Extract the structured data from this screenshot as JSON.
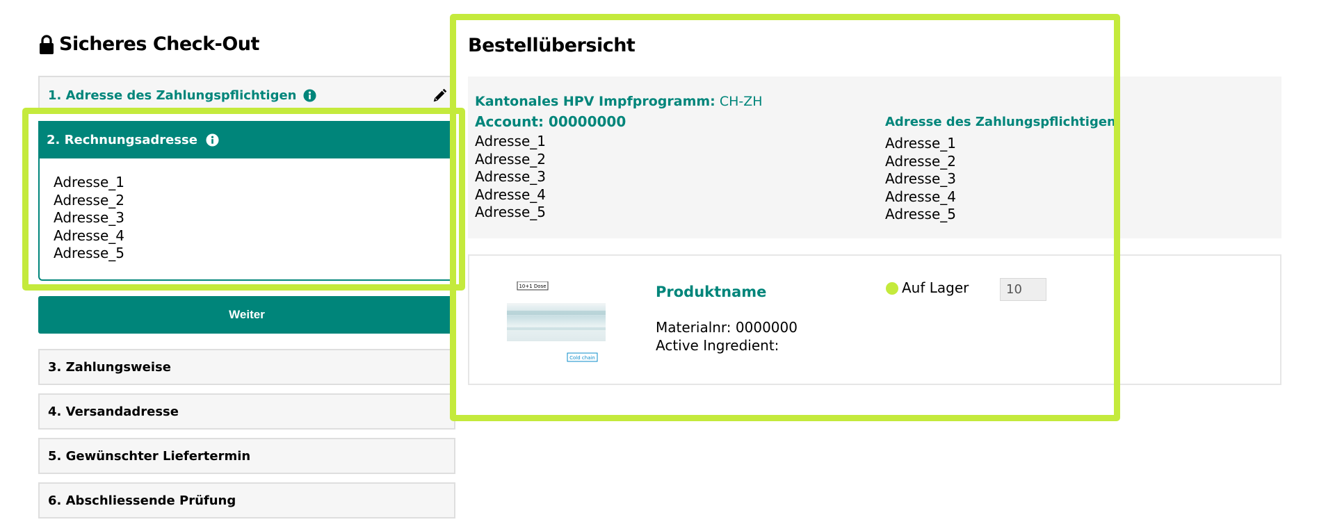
{
  "left": {
    "title": "Sicheres Check-Out",
    "steps": [
      {
        "label": "1.  Adresse des Zahlungspflichtigen"
      },
      {
        "label": "2. Rechnungsadresse"
      },
      {
        "label": "3. Zahlungsweise"
      },
      {
        "label": "4. Versandadresse"
      },
      {
        "label": "5. Gewünschter Liefertermin"
      },
      {
        "label": "6. Abschliessende Prüfung"
      }
    ],
    "billing_address": [
      "Adresse_1",
      "Adresse_2",
      "Adresse_3",
      "Adresse_4",
      "Adresse_5"
    ],
    "continue_label": "Weiter"
  },
  "summary": {
    "title": "Bestellübersicht",
    "program_label": "Kantonales HPV Impfprogramm:",
    "program_value": " CH-ZH",
    "account": "Account: 00000000",
    "account_address": [
      "Adresse_1",
      "Adresse_2",
      "Adresse_3",
      "Adresse_4",
      "Adresse_5"
    ],
    "payer_title": "Adresse des Zahlungspflichtigen:",
    "payer_address": [
      "Adresse_1",
      "Adresse_2",
      "Adresse_3",
      "Adresse_4",
      "Adresse_5"
    ]
  },
  "product": {
    "name": "Produktname",
    "material": "Materialnr: 0000000",
    "ingredient": "Active Ingredient:",
    "image_tag_top": "10+1 Dose",
    "image_tag_bottom": "Cold chain",
    "stock_label": "Auf Lager",
    "quantity": "10"
  },
  "colors": {
    "brand": "#00857a",
    "highlight": "#c4ea3c",
    "stock": "#c4ea3c"
  }
}
